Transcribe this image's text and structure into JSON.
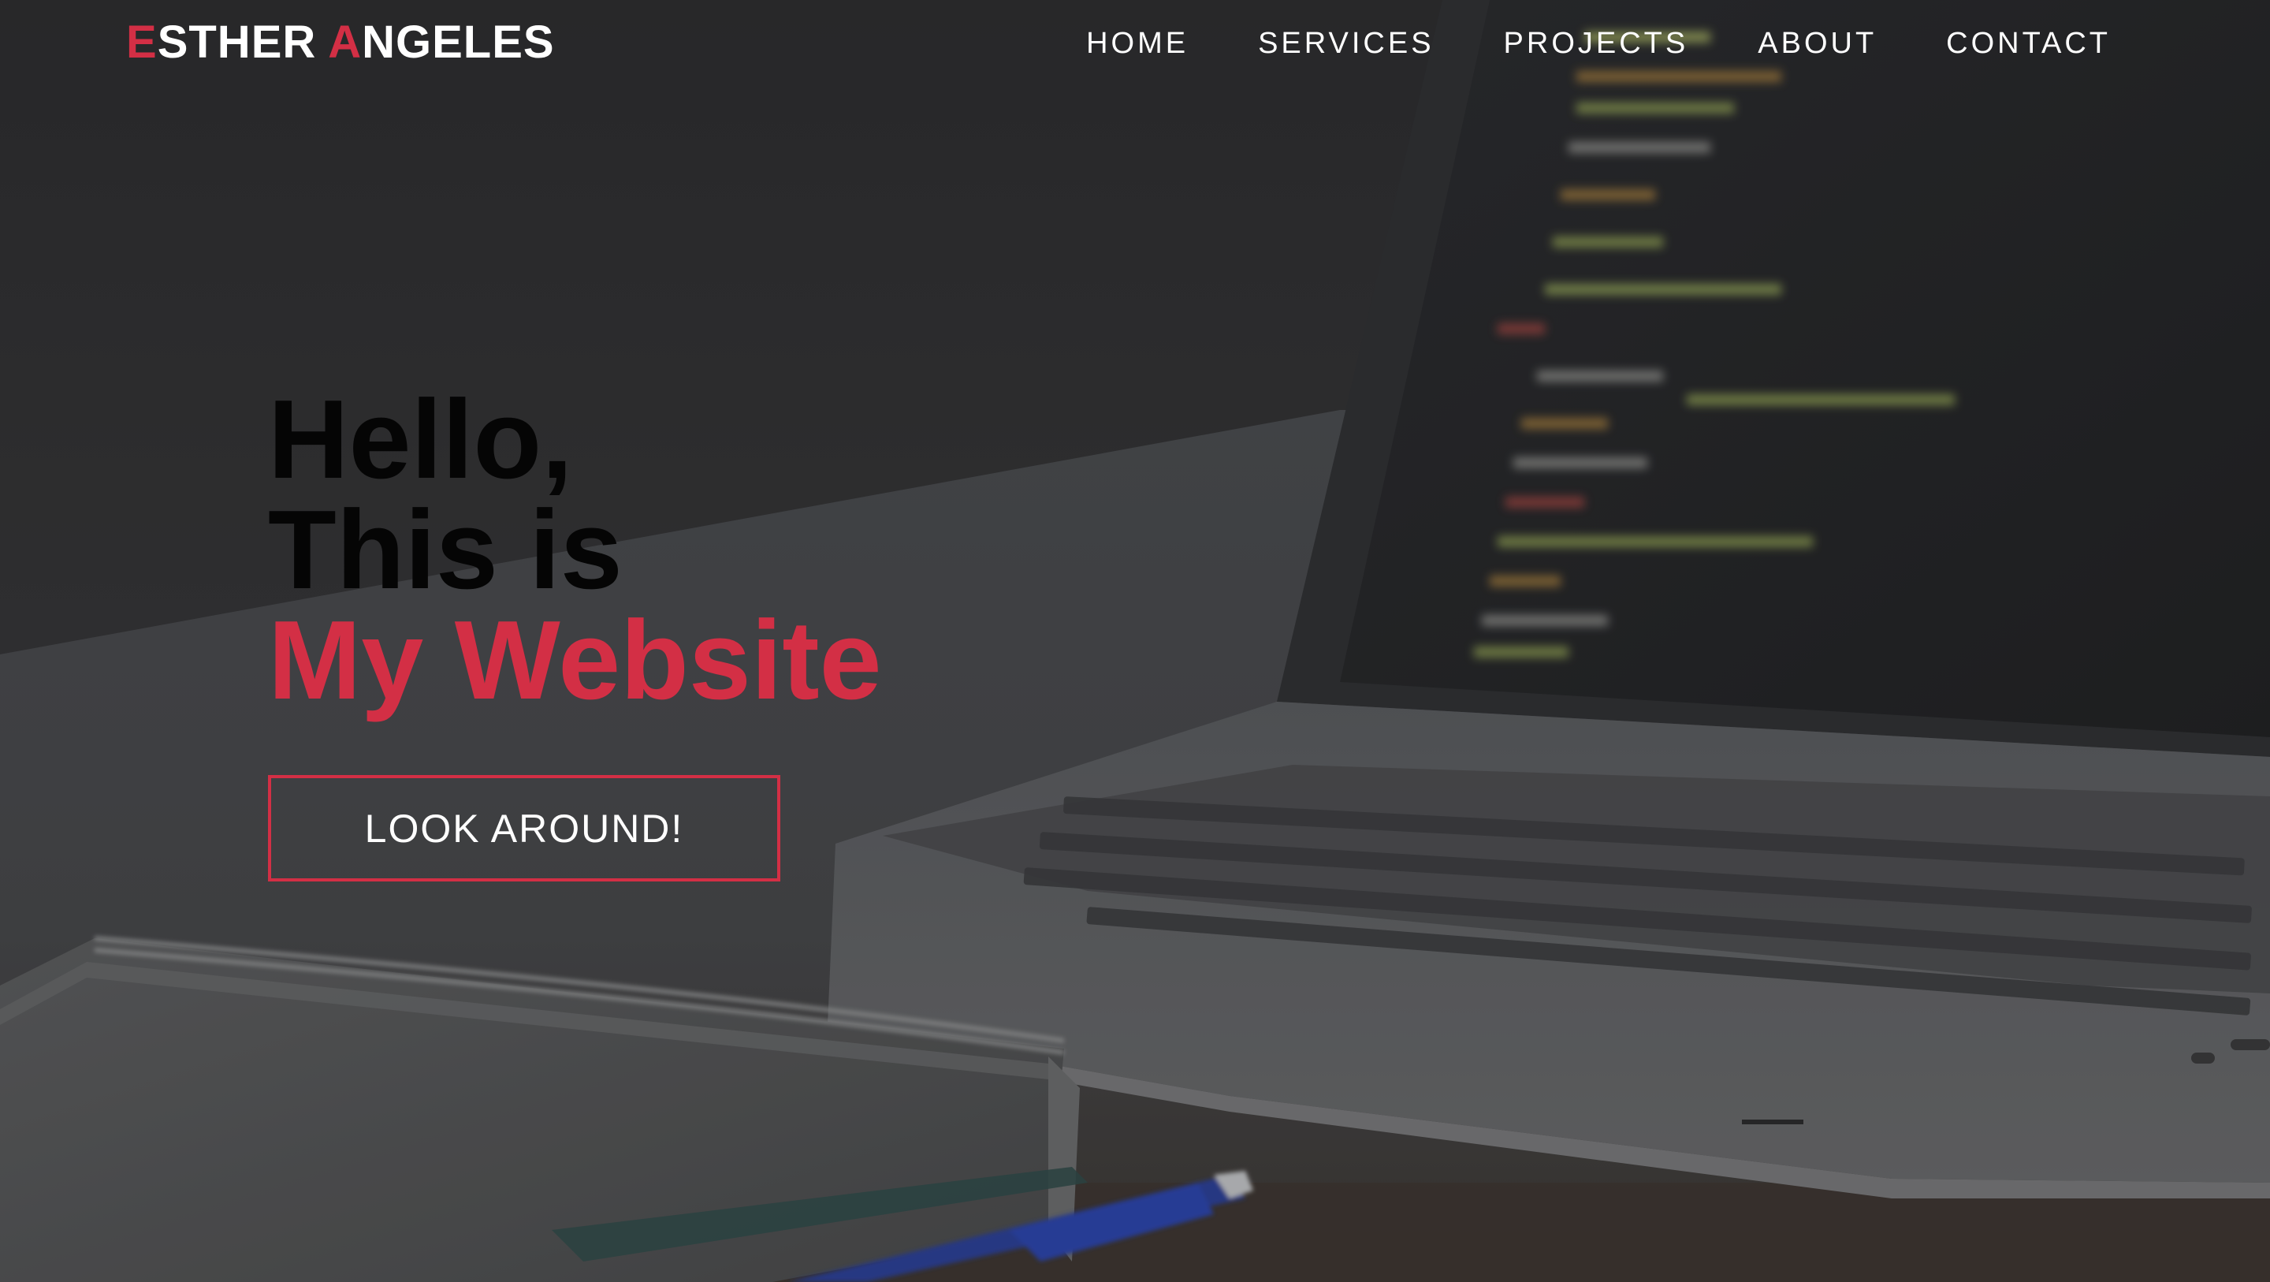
{
  "brand": {
    "first_initial": "E",
    "first_rest": "STHER ",
    "last_initial": "A",
    "last_rest": "NGELES",
    "accent_color": "#d32f45"
  },
  "nav": {
    "items": [
      {
        "label": "HOME"
      },
      {
        "label": "SERVICES"
      },
      {
        "label": "PROJECTS"
      },
      {
        "label": "ABOUT"
      },
      {
        "label": "CONTACT"
      }
    ]
  },
  "hero": {
    "line1": "Hello,",
    "line2": "This is",
    "line3": "My Website",
    "cta_label": "LOOK AROUND!",
    "background": "laptop-desk-photo"
  }
}
